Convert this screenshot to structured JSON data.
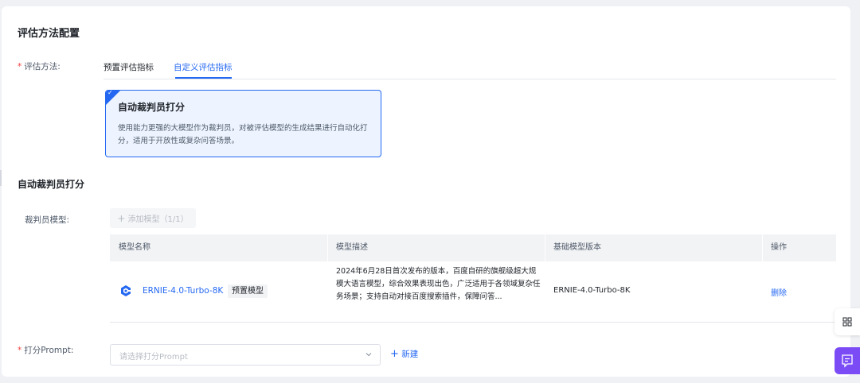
{
  "section1": {
    "title": "评估方法配置",
    "method_label": "评估方法:",
    "tabs": [
      {
        "label": "预置评估指标",
        "active": false
      },
      {
        "label": "自定义评估指标",
        "active": true
      }
    ],
    "card": {
      "title": "自动裁判员打分",
      "description": "使用能力更强的大模型作为裁判员，对被评估模型的生成结果进行自动化打分，适用于开放性或复杂问答场景。",
      "selected": true
    }
  },
  "section2": {
    "title": "自动裁判员打分",
    "judge_label": "裁判员模型:",
    "add_model_button": "添加模型（1/1）",
    "table": {
      "headers": [
        "模型名称",
        "模型描述",
        "基础模型版本",
        "操作"
      ],
      "rows": [
        {
          "name": "ERNIE-4.0-Turbo-8K",
          "tag": "预置模型",
          "description": "2024年6月28日首次发布的版本，百度自研的旗舰级超大规模大语言模型，综合效果表现出色，广泛适用于各领域复杂任务场景；支持自动对接百度搜索插件，保障问答...",
          "base_version": "ERNIE-4.0-Turbo-8K",
          "action": "删除"
        }
      ]
    },
    "prompt_label": "打分Prompt:",
    "prompt_placeholder": "请选择打分Prompt",
    "new_button": "新建"
  },
  "colors": {
    "accent": "#2468f2",
    "required": "#f53f3f",
    "chat_button": "#7b4cf6"
  }
}
